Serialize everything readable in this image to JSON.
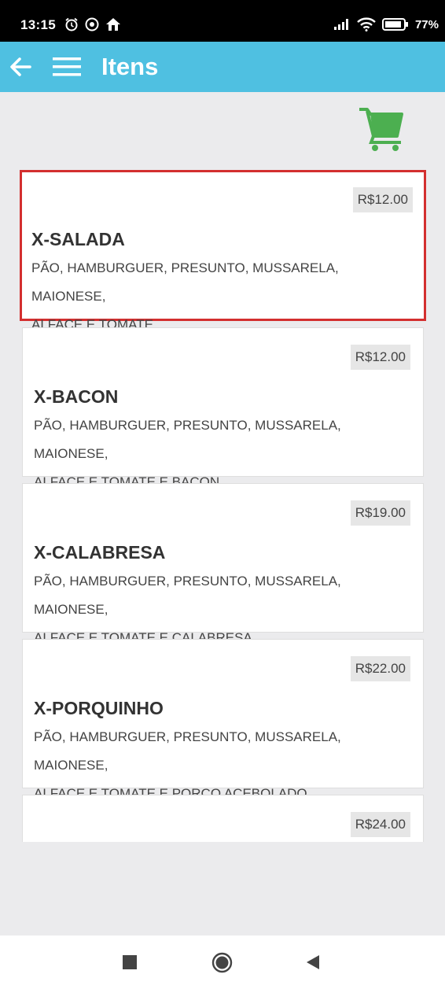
{
  "status_bar": {
    "time": "13:15",
    "battery": "77%"
  },
  "app_bar": {
    "title": "Itens"
  },
  "items": [
    {
      "price": "R$12.00",
      "name": "X-SALADA",
      "desc_line1": "PÃO, HAMBURGUER, PRESUNTO, MUSSARELA, MAIONESE,",
      "desc_line2": "ALFACE E TOMATE"
    },
    {
      "price": "R$12.00",
      "name": "X-BACON",
      "desc_line1": "PÃO, HAMBURGUER, PRESUNTO, MUSSARELA, MAIONESE,",
      "desc_line2": "ALFACE E TOMATE E BACON"
    },
    {
      "price": "R$19.00",
      "name": "X-CALABRESA",
      "desc_line1": "PÃO, HAMBURGUER, PRESUNTO, MUSSARELA, MAIONESE,",
      "desc_line2": "ALFACE E TOMATE E CALABRESA"
    },
    {
      "price": "R$22.00",
      "name": "X-PORQUINHO",
      "desc_line1": "PÃO, HAMBURGUER, PRESUNTO, MUSSARELA, MAIONESE,",
      "desc_line2": "ALFACE E TOMATE E PORCO ACEBOLADO"
    },
    {
      "price": "R$24.00"
    }
  ],
  "colors": {
    "app_bar": "#4fc0e1",
    "cart": "#4caf50",
    "selection": "#d32f2f"
  },
  "icons": {
    "back": "arrow-left-icon",
    "menu": "hamburger-menu-icon",
    "cart": "shopping-cart-icon"
  }
}
